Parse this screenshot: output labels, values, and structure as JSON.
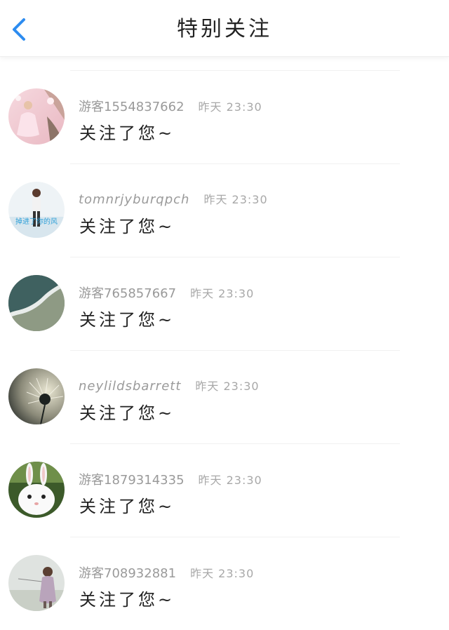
{
  "header": {
    "title": "特别关注",
    "back_icon": "chevron-left-icon",
    "accent_color": "#2d8cf0"
  },
  "items": [
    {
      "name": "游客1554837662",
      "time": "昨天 23:30",
      "message": "关注了您~",
      "avatar": "girl-in-pink-dress-avatar"
    },
    {
      "name": "tomnrjyburqpch",
      "time": "昨天 23:30",
      "message": "关注了您~",
      "avatar": "girl-walking-avatar",
      "avatar_text": "掉进了你的风"
    },
    {
      "name": "游客765857667",
      "time": "昨天 23:30",
      "message": "关注了您~",
      "avatar": "ocean-waves-avatar"
    },
    {
      "name": "neylildsbarrett",
      "time": "昨天 23:30",
      "message": "关注了您~",
      "avatar": "dandelion-avatar"
    },
    {
      "name": "游客1879314335",
      "time": "昨天 23:30",
      "message": "关注了您~",
      "avatar": "white-rabbit-avatar"
    },
    {
      "name": "游客708932881",
      "time": "昨天 23:30",
      "message": "关注了您~",
      "avatar": "child-with-balloon-avatar"
    }
  ]
}
